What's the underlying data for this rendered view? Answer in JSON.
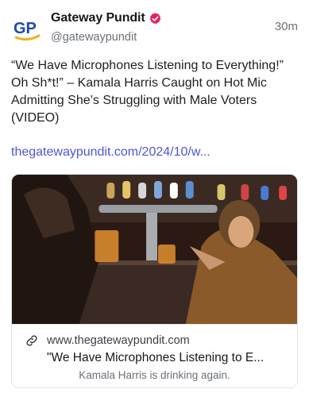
{
  "post": {
    "author": {
      "display_name": "Gateway Pundit",
      "handle": "@gatewaypundit",
      "avatar_text": "GP",
      "verified_icon": "verified-badge-icon",
      "brand_color": "#1f4aa8",
      "accent_color": "#f2b01e"
    },
    "timestamp": "30m",
    "text": "“We Have Microphones Listening to Everything!” Oh Sh*t!” – Kamala Harris Caught on Hot Mic Admitting She’s Struggling with Male Voters (VIDEO)",
    "link_text": "thegatewaypundit.com/2024/10/w...",
    "link_color": "#4a57d8",
    "link_card": {
      "domain": "www.thegatewaypundit.com",
      "title": "\"We Have Microphones Listening to E...",
      "description": "Kamala Harris is drinking again.",
      "link_icon": "link-icon"
    }
  }
}
